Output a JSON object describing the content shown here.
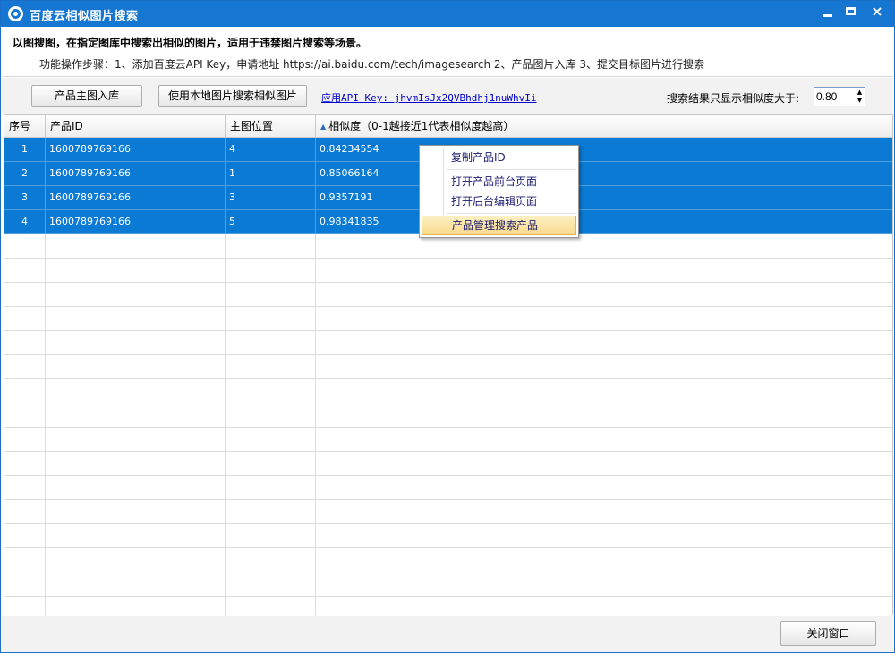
{
  "window": {
    "title": "百度云相似图片搜索",
    "minimize_label": "",
    "close_label": "×"
  },
  "description": {
    "headline": "以图搜图，在指定图库中搜索出相似的图片，适用于违禁图片搜索等场景。",
    "steps": "功能操作步骤：1、添加百度云API Key，申请地址 https://ai.baidu.com/tech/imagesearch    2、产品图片入库    3、提交目标图片进行搜索"
  },
  "toolbar": {
    "import_button": "产品主图入库",
    "search_local_button": "使用本地图片搜索相似图片",
    "api_link": "应用API Key: jhvmIsJx2QVBhdhj1nuWhvIi",
    "threshold_label": "搜索结果只显示相似度大于:",
    "threshold_value": "0.80",
    "spin_up": "▲",
    "spin_down": "▼"
  },
  "table": {
    "columns": [
      "序号",
      "产品ID",
      "主图位置",
      "相似度（0-1越接近1代表相似度越高）"
    ],
    "sort_indicator": "▲",
    "rows": [
      [
        "1",
        "1600789769166",
        "4",
        "0.84234554"
      ],
      [
        "2",
        "1600789769166",
        "1",
        "0.85066164"
      ],
      [
        "3",
        "1600789769166",
        "3",
        "0.9357191"
      ],
      [
        "4",
        "1600789769166",
        "5",
        "0.98341835"
      ]
    ]
  },
  "context_menu": {
    "items": [
      "复制产品ID",
      "打开产品前台页面",
      "打开后台编辑页面",
      "产品管理搜索产品"
    ]
  },
  "footer": {
    "close_button": "关闭窗口"
  },
  "colors": {
    "titlebar": "#1677d2",
    "selection": "#0a7ad4",
    "menu_highlight": "#f8d98c"
  }
}
